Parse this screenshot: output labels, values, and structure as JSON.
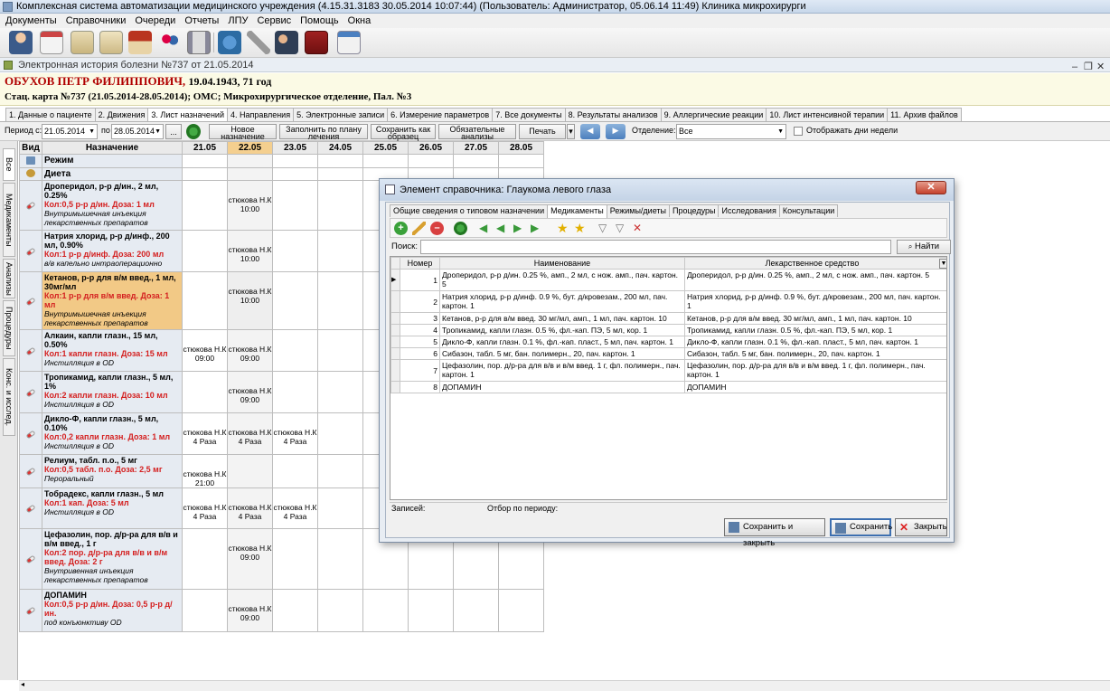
{
  "window": {
    "title": "Комплексная система автоматизации медицинского учреждения (4.15.31.3183 30.05.2014 10:07:44) (Пользователь: Администратор, 05.06.14 11:49) Клиника микрохирурги"
  },
  "menu": [
    "Документы",
    "Справочники",
    "Очереди",
    "Отчеты",
    "ЛПУ",
    "Сервис",
    "Помощь",
    "Окна"
  ],
  "document": {
    "title": "Электронная история болезни №737 от 21.05.2014"
  },
  "patient": {
    "name": "ОБУХОВ ПЕТР ФИЛИППОВИЧ,",
    "birth": "19.04.1943, 71 год",
    "card": "Стац. карта №737 (21.05.2014-28.05.2014); ОМС; Микрохирургическое отделение, Пал. №3"
  },
  "tabs": [
    "1. Данные о пациенте",
    "2. Движения",
    "3. Лист назначений",
    "4. Направления",
    "5. Электронные записи",
    "6. Измерение параметров",
    "7. Все документы",
    "8. Результаты анализов",
    "9. Аллергические реакции",
    "10. Лист интенсивной терапии",
    "11. Архив файлов"
  ],
  "active_tab": "3. Лист назначений",
  "filter": {
    "period_label": "Период с:",
    "date_from": "21.05.2014",
    "to_label": "по",
    "date_to": "28.05.2014",
    "dots": "...",
    "new_btn": "Новое назначение",
    "fill_btn": "Заполнить по плану лечения",
    "save_tpl_btn": "Сохранить как образец",
    "required_btn": "Обязательные анализы",
    "print_btn": "Печать",
    "dept_label": "Отделение:",
    "dept_value": "Все",
    "show_days_label": "Отображать дни недели"
  },
  "sidebar_tabs": [
    "Все",
    "Медикаменты",
    "Анализы",
    "Процедуры",
    "Конс. и исслед."
  ],
  "grid": {
    "col_kind": "Вид",
    "col_presc": "Назначение",
    "dates": [
      "21.05",
      "22.05",
      "23.05",
      "24.05",
      "25.05",
      "26.05",
      "27.05",
      "28.05"
    ],
    "today": "22.05",
    "sections": [
      {
        "label": "Режим"
      },
      {
        "label": "Диета"
      }
    ],
    "rows": [
      {
        "name": "Дроперидол, р-р д/ин., 2 мл, 0.25%",
        "dose": "Кол:0,5 р-р д/ин. Доза: 1 мл",
        "route": "Внутримышечная инъекция лекарственных препаратов",
        "cells": [
          "",
          "стюкова Н.К\n10:00",
          "",
          "",
          "",
          "",
          "",
          ""
        ]
      },
      {
        "name": "Натрия хлорид, р-р д/инф., 200 мл, 0.90%",
        "dose": "Кол:1 р-р д/инф. Доза: 200 мл",
        "route": "в/в капельно интраоперационно",
        "cells": [
          "",
          "стюкова Н.К\n10:00",
          "",
          "",
          "",
          "",
          "",
          ""
        ]
      },
      {
        "name": "Кетанов, р-р для в/м введ., 1 мл, 30мг/мл",
        "dose": "Кол:1 р-р для в/м введ. Доза: 1 мл",
        "route": "Внутримышечная инъекция лекарственных препаратов",
        "cells": [
          "",
          "стюкова Н.К\n10:00",
          "",
          "",
          "",
          "",
          "",
          ""
        ],
        "selected": true
      },
      {
        "name": "Алкаин, капли глазн., 15 мл, 0.50%",
        "dose": "Кол:1 капли глазн. Доза: 15 мл",
        "route": "Инстилляция в OD",
        "cells": [
          "стюкова Н.К\n09:00",
          "стюкова Н.К\n09:00",
          "",
          "",
          "",
          "",
          "",
          ""
        ]
      },
      {
        "name": "Тропикамид, капли глазн., 5 мл, 1%",
        "dose": "Кол:2 капли глазн. Доза: 10 мл",
        "route": "Инстилляция в OD",
        "cells": [
          "",
          "стюкова Н.К\n09:00",
          "",
          "",
          "",
          "",
          "",
          ""
        ]
      },
      {
        "name": "Дикло-Ф, капли глазн., 5 мл, 0.10%",
        "dose": "Кол:0,2 капли глазн. Доза: 1 мл",
        "route": "Инстилляция в OD",
        "cells": [
          "стюкова Н.К\n4 Раза",
          "стюкова Н.К\n4 Раза",
          "стюкова Н.К\n4 Раза",
          "",
          "",
          "",
          "",
          ""
        ]
      },
      {
        "name": "Релиум, табл. п.о., 5 мг",
        "dose": "Кол:0,5 табл. п.о. Доза: 2,5 мг",
        "route": "Пероральный",
        "cells": [
          "стюкова Н.К\n21:00",
          "",
          "",
          "",
          "",
          "",
          "",
          ""
        ]
      },
      {
        "name": "Тобрадекс, капли глазн., 5 мл",
        "dose": "Кол:1 кап. Доза: 5 мл",
        "route": "Инстилляция в OD",
        "cells": [
          "стюкова Н.К\n4 Раза",
          "стюкова Н.К\n4 Раза",
          "стюкова Н.К\n4 Раза",
          "",
          "",
          "",
          "",
          ""
        ]
      },
      {
        "name": "Цефазолин, пор. д/р-ра для в/в и в/м введ., 1 г",
        "dose": "Кол:2 пор. д/р-ра для в/в и в/м введ. Доза: 2 г",
        "route": "Внутривенная инъекция лекарственных препаратов",
        "cells": [
          "",
          "стюкова Н.К\n09:00",
          "",
          "",
          "",
          "",
          "",
          ""
        ]
      },
      {
        "name": "ДОПАМИН",
        "dose": "Кол:0,5 р-р д/ин. Доза: 0,5 р-р д/ин.",
        "route": "под конъюнктиву OD",
        "cells": [
          "",
          "стюкова Н.К\n09:00",
          "",
          "",
          "",
          "",
          "",
          ""
        ]
      }
    ]
  },
  "dialog": {
    "title": "Элемент справочника: Глаукома левого глаза",
    "tabs": [
      "Общие сведения о типовом назначении",
      "Медикаменты",
      "Режимы/диеты",
      "Процедуры",
      "Исследования",
      "Консультации"
    ],
    "active_tab": "Медикаменты",
    "search_label": "Поиск:",
    "find_btn": "Найти",
    "columns": [
      "Номер",
      "Наименование",
      "Лекарственное средство"
    ],
    "rows": [
      {
        "num": "1",
        "name": "Дроперидол, р-р д/ин. 0.25 %, амп., 2 мл, с нож. амп., пач. картон. 5",
        "drug": "Дроперидол, р-р д/ин. 0.25 %, амп., 2 мл, с нож. амп., пач. картон. 5"
      },
      {
        "num": "2",
        "name": "Натрия хлорид, р-р д/инф. 0.9 %, бут. д/кровезам., 200 мл, пач. картон. 1",
        "drug": "Натрия хлорид, р-р д/инф. 0.9 %, бут. д/кровезам., 200 мл, пач. картон. 1"
      },
      {
        "num": "3",
        "name": "Кетанов, р-р для в/м введ. 30 мг/мл, амп., 1 мл, пач. картон. 10",
        "drug": "Кетанов, р-р для в/м введ. 30 мг/мл, амп., 1 мл, пач. картон. 10"
      },
      {
        "num": "4",
        "name": "Тропикамид, капли глазн. 0.5 %, фл.-кап. ПЭ, 5 мл, кор. 1",
        "drug": "Тропикамид, капли глазн. 0.5 %, фл.-кап. ПЭ, 5 мл, кор. 1"
      },
      {
        "num": "5",
        "name": "Дикло-Ф, капли глазн. 0.1 %, фл.-кап. пласт., 5 мл, пач. картон. 1",
        "drug": "Дикло-Ф, капли глазн. 0.1 %, фл.-кап. пласт., 5 мл, пач. картон. 1"
      },
      {
        "num": "6",
        "name": "Сибазон, табл. 5 мг, бан. полимерн., 20, пач. картон. 1",
        "drug": "Сибазон, табл. 5 мг, бан. полимерн., 20, пач. картон. 1"
      },
      {
        "num": "7",
        "name": "Цефазолин, пор. д/р-ра для в/в и в/м введ. 1 г, фл. полимерн., пач. картон. 1",
        "drug": "Цефазолин, пор. д/р-ра для в/в и в/м введ. 1 г, фл. полимерн., пач. картон. 1"
      },
      {
        "num": "8",
        "name": "ДОПАМИН",
        "drug": "ДОПАМИН"
      }
    ],
    "records_label": "Записей:",
    "period_filter_label": "Отбор по периоду:",
    "btn_save_close": "Сохранить и закрыть",
    "btn_save": "Сохранить",
    "btn_close": "Закрыть"
  },
  "colors": {
    "accent_today": "#f4cf8f",
    "selected_row": "#f2c986",
    "patient_name": "#b00000",
    "dose_red": "#d42020"
  }
}
